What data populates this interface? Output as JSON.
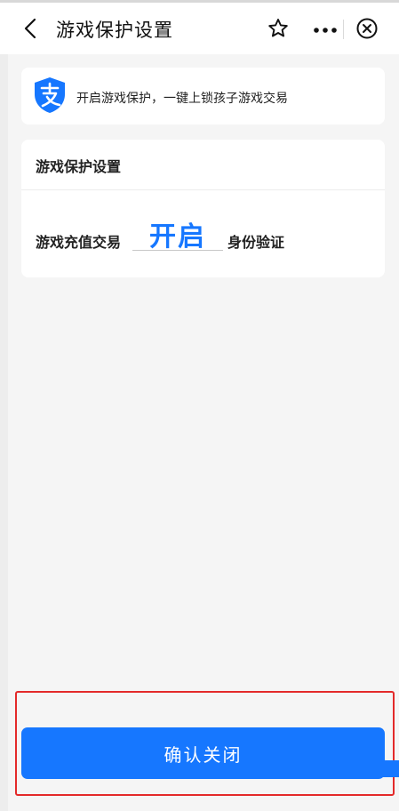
{
  "nav": {
    "title": "游戏保护设置",
    "back_icon": "chevron-left-icon",
    "favorite_icon": "star-outline-icon",
    "more_icon": "more-dots-icon",
    "close_icon": "close-circle-icon"
  },
  "banner": {
    "icon": "alipay-shield-icon",
    "text": "开启游戏保护，一键上锁孩子游戏交易"
  },
  "settings": {
    "title": "游戏保护设置",
    "row_label": "游戏充值交易",
    "toggle_value": "开启",
    "row_suffix": "身份验证"
  },
  "footer": {
    "confirm_label": "确认关闭"
  },
  "colors": {
    "accent": "#1677ff",
    "highlight_border": "#e32a2a",
    "background": "#f5f5f5"
  }
}
